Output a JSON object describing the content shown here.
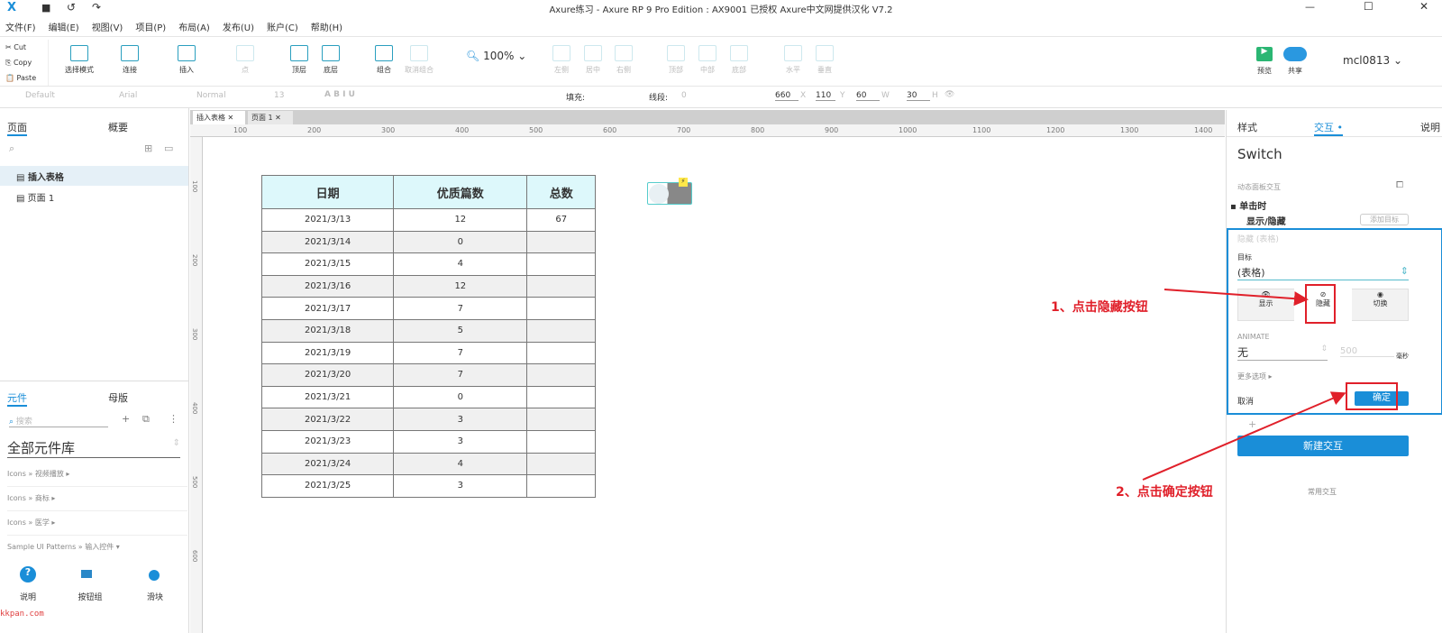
{
  "window": {
    "title": "Axure练习 - Axure RP 9 Pro Edition : AX9001 已授权    Axure中文网提供汉化 V7.2"
  },
  "menu": [
    "文件(F)",
    "编辑(E)",
    "视图(V)",
    "项目(P)",
    "布局(A)",
    "发布(U)",
    "账户(C)",
    "帮助(H)"
  ],
  "clipboard": [
    "Cut",
    "Copy",
    "Paste"
  ],
  "toolbar": {
    "select_mode": "选择模式",
    "connect": "连接",
    "insert": "插入",
    "point": "点",
    "top": "顶层",
    "bottom": "底层",
    "group": "组合",
    "ungroup": "取消组合",
    "zoom": "100%",
    "align_left": "左侧",
    "align_center": "居中",
    "align_right": "右侧",
    "align_top": "顶部",
    "align_middle": "中部",
    "align_bottom": "底部",
    "dist_h": "水平",
    "dist_v": "垂直",
    "preview": "预览",
    "share": "共享",
    "user": "mcl0813"
  },
  "format": {
    "style": "Default",
    "font": "Arial",
    "weight": "Normal",
    "size": "13",
    "fill_label": "填充:",
    "line_label": "线段:",
    "line_value": "0",
    "x": "660",
    "y": "110",
    "w": "60",
    "h": "30",
    "x_label": "X",
    "y_label": "Y",
    "w_label": "W",
    "h_label": "H"
  },
  "pages_panel": {
    "tabs": [
      "页面",
      "概要"
    ],
    "pages": [
      "插入表格",
      "页面 1"
    ]
  },
  "widgets_panel": {
    "tabs": [
      "元件",
      "母版"
    ],
    "search_placeholder": "搜索",
    "library": "全部元件库",
    "groups": [
      "Icons » 视频播放 ▸",
      "Icons » 商标 ▸",
      "Icons » 医学 ▸",
      "Sample UI Patterns » 输入控件 ▾"
    ],
    "items": [
      "说明",
      "按钮组",
      "滑块"
    ]
  },
  "canvas": {
    "tabs": [
      "插入表格",
      "页面 1"
    ],
    "ruler_h": [
      "100",
      "200",
      "300",
      "400",
      "500",
      "600",
      "700",
      "800",
      "900",
      "1000",
      "1100",
      "1200",
      "1300",
      "1400"
    ],
    "ruler_v": [
      "100",
      "200",
      "300",
      "400",
      "500",
      "600"
    ]
  },
  "table": {
    "headers": [
      "日期",
      "优质篇数",
      "总数"
    ],
    "rows": [
      [
        "2021/3/13",
        "12",
        "67"
      ],
      [
        "2021/3/14",
        "0",
        ""
      ],
      [
        "2021/3/15",
        "4",
        ""
      ],
      [
        "2021/3/16",
        "12",
        ""
      ],
      [
        "2021/3/17",
        "7",
        ""
      ],
      [
        "2021/3/18",
        "5",
        ""
      ],
      [
        "2021/3/19",
        "7",
        ""
      ],
      [
        "2021/3/20",
        "7",
        ""
      ],
      [
        "2021/3/21",
        "0",
        ""
      ],
      [
        "2021/3/22",
        "3",
        ""
      ],
      [
        "2021/3/23",
        "3",
        ""
      ],
      [
        "2021/3/24",
        "4",
        ""
      ],
      [
        "2021/3/25",
        "3",
        ""
      ]
    ]
  },
  "right_panel": {
    "tabs": [
      "样式",
      "交互 •",
      "说明"
    ],
    "widget_name": "Switch",
    "section": "动态面板交互",
    "event": "单击时",
    "action": "显示/隐藏",
    "add_target": "添加目标",
    "action_summary": "隐藏 (表格)",
    "target_label": "目标",
    "target_value": "(表格)",
    "modes": [
      "显示",
      "隐藏",
      "切换"
    ],
    "animate_label": "ANIMATE",
    "animate_value": "无",
    "duration": "500",
    "duration_unit": "毫秒",
    "more": "更多选项 ▸",
    "cancel": "取消",
    "ok": "确定",
    "new_interaction": "新建交互",
    "common": "常用交互"
  },
  "annotations": [
    "1、点击隐藏按钮",
    "2、点击确定按钮"
  ],
  "watermark": "kkpan.com",
  "colors": {
    "accent": "#1a8ed8",
    "annotation": "#e0202a",
    "header_fill": "#ddf8fb"
  }
}
